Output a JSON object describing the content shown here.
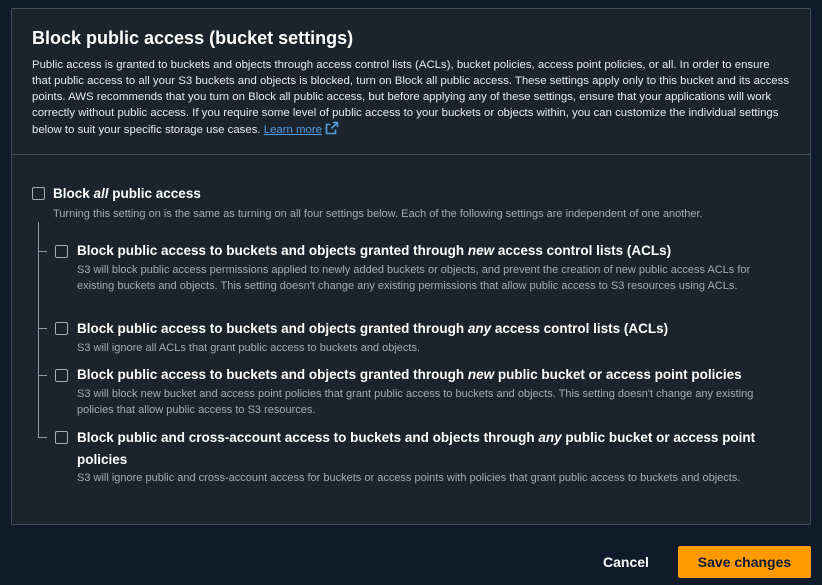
{
  "section": {
    "title": "Block public access (bucket settings)",
    "description": "Public access is granted to buckets and objects through access control lists (ACLs), bucket policies, access point policies, or all. In order to ensure that public access to all your S3 buckets and objects is blocked, turn on Block all public access. These settings apply only to this bucket and its access points. AWS recommends that you turn on Block all public access, but before applying any of these settings, ensure that your applications will work correctly without public access. If you require some level of public access to your buckets or objects within, you can customize the individual settings below to suit your specific storage use cases.",
    "learn_more": "Learn more"
  },
  "block_all": {
    "label_pre": "Block ",
    "label_em": "all",
    "label_post": " public access",
    "description": "Turning this setting on is the same as turning on all four settings below. Each of the following settings are independent of one another.",
    "checked": false
  },
  "settings": [
    {
      "label_pre": "Block public access to buckets and objects granted through ",
      "label_em": "new",
      "label_post": " access control lists (ACLs)",
      "description": "S3 will block public access permissions applied to newly added buckets or objects, and prevent the creation of new public access ACLs for existing buckets and objects. This setting doesn't change any existing permissions that allow public access to S3 resources using ACLs.",
      "checked": false
    },
    {
      "label_pre": "Block public access to buckets and objects granted through ",
      "label_em": "any",
      "label_post": " access control lists (ACLs)",
      "description": "S3 will ignore all ACLs that grant public access to buckets and objects.",
      "checked": false
    },
    {
      "label_pre": "Block public access to buckets and objects granted through ",
      "label_em": "new",
      "label_post": " public bucket or access point policies",
      "description": "S3 will block new bucket and access point policies that grant public access to buckets and objects. This setting doesn't change any existing policies that allow public access to S3 resources.",
      "checked": false
    },
    {
      "label_pre": "Block public and cross-account access to buckets and objects through ",
      "label_em": "any",
      "label_post": " public bucket or access point policies",
      "description": "S3 will ignore public and cross-account access for buckets or access points with policies that grant public access to buckets and objects.",
      "checked": false
    }
  ],
  "actions": {
    "cancel": "Cancel",
    "save": "Save changes"
  },
  "colors": {
    "primary": "#ff9900",
    "link": "#539fe5",
    "panel_bg": "#1b232d",
    "page_bg": "#0f1b2a"
  },
  "icons": {
    "external_link": "external-link-icon"
  }
}
